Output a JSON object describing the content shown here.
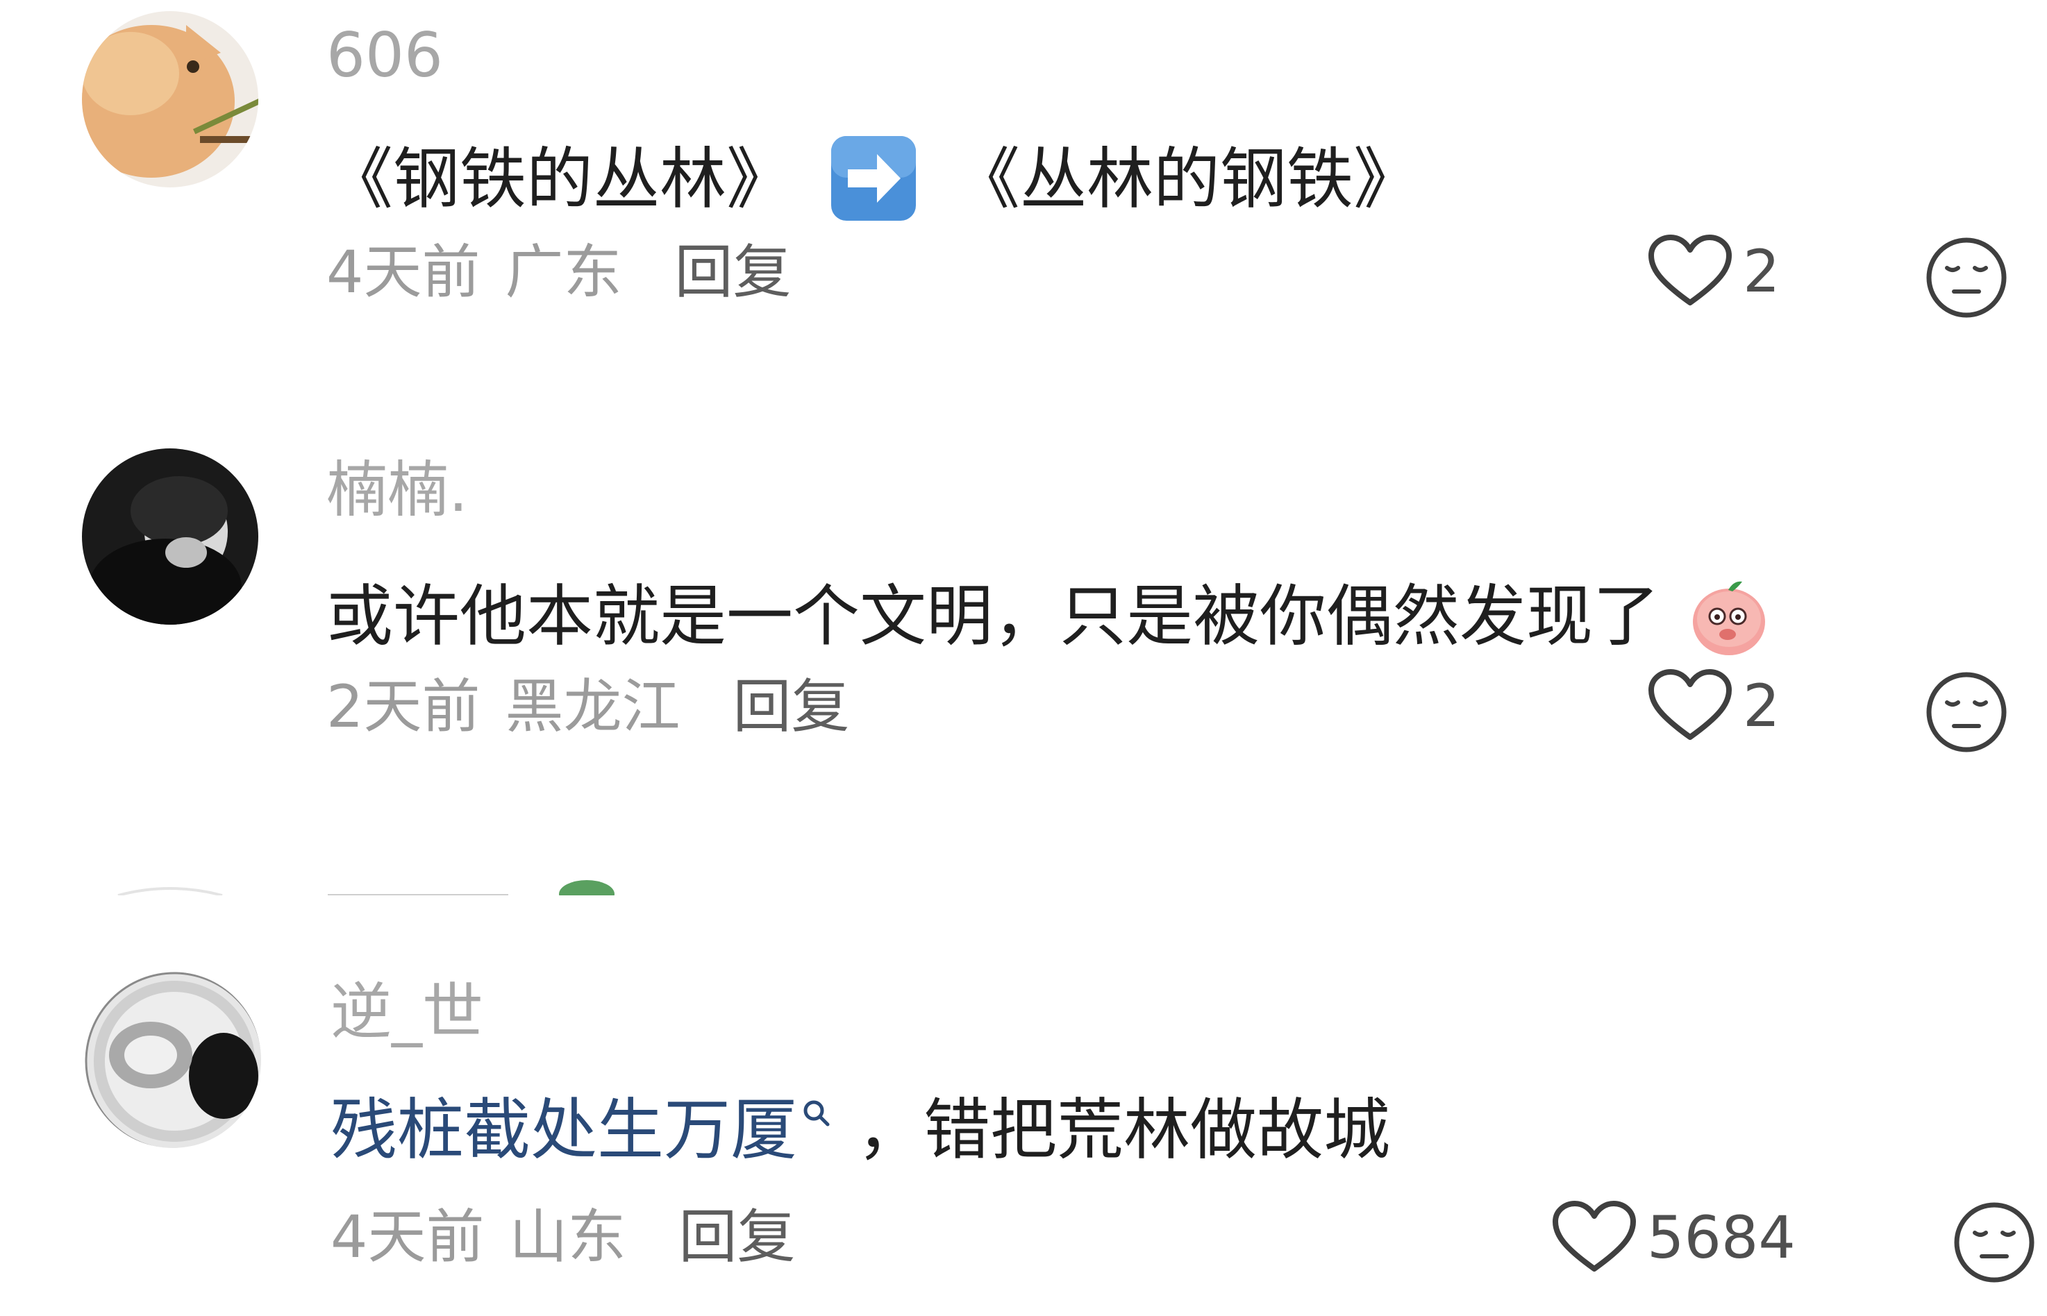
{
  "comments": [
    {
      "username": "606",
      "content_before": "《钢铁的丛林》",
      "emoji": "right-arrow-emoji",
      "content_after": "《丛林的钢铁》",
      "time": "4天前",
      "region": "广东",
      "reply_label": "回复",
      "likes": "2"
    },
    {
      "username": "楠楠.",
      "content": "或许他本就是一个文明，只是被你偶然发现了",
      "emoji": "shy-peach-emoji",
      "time": "2天前",
      "region": "黑龙江",
      "reply_label": "回复",
      "likes": "2"
    },
    {
      "username": "逆_世",
      "topic": "残桩截处生万厦",
      "content": "，错把荒林做故城",
      "time": "4天前",
      "region": "山东",
      "reply_label": "回复",
      "likes": "5684"
    }
  ],
  "colors": {
    "username": "#a7a7a7",
    "content": "#1f1f1f",
    "meta": "#9b9b9b",
    "reply": "#5e5e5e",
    "topic": "#2a4a78",
    "arrow_emoji_bg": "#4a90d9"
  }
}
